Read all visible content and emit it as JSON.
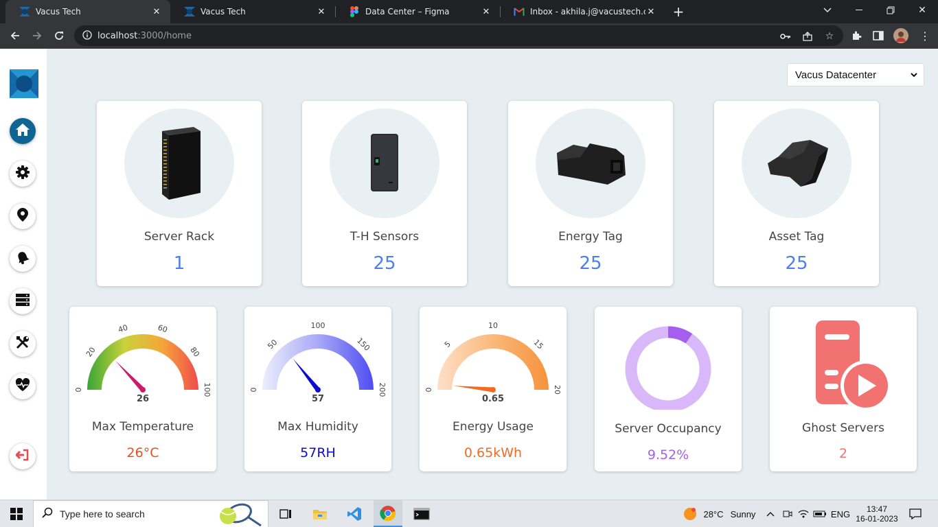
{
  "browser": {
    "tabs": [
      {
        "title": "Vacus Tech",
        "icon": "vacus-logo-icon",
        "active": true
      },
      {
        "title": "Vacus Tech",
        "icon": "vacus-logo-icon",
        "active": false
      },
      {
        "title": "Data Center – Figma",
        "icon": "figma-icon",
        "active": false
      },
      {
        "title": "Inbox - akhila.j@vacustech.com -",
        "icon": "gmail-icon",
        "active": false
      }
    ],
    "url_host": "localhost",
    "url_path": ":3000/home"
  },
  "sidebar": {
    "items": [
      {
        "name": "home",
        "icon": "home-icon",
        "active": true
      },
      {
        "name": "settings",
        "icon": "gear-icon",
        "active": false
      },
      {
        "name": "location",
        "icon": "location-pin-icon",
        "active": false
      },
      {
        "name": "alerts",
        "icon": "bell-icon",
        "active": false
      },
      {
        "name": "servers",
        "icon": "server-icon",
        "active": false
      },
      {
        "name": "tools",
        "icon": "tools-icon",
        "active": false
      },
      {
        "name": "health",
        "icon": "heartbeat-icon",
        "active": false
      },
      {
        "name": "logout",
        "icon": "logout-icon",
        "active": false
      }
    ]
  },
  "datacenter_select": {
    "value": "Vacus Datacenter"
  },
  "device_cards": [
    {
      "label": "Server Rack",
      "count": "1",
      "image": "server-rack-image"
    },
    {
      "label": "T-H Sensors",
      "count": "25",
      "image": "th-sensor-image"
    },
    {
      "label": "Energy Tag",
      "count": "25",
      "image": "energy-tag-image"
    },
    {
      "label": "Asset Tag",
      "count": "25",
      "image": "asset-tag-image"
    }
  ],
  "gauges": [
    {
      "label": "Max Temperature",
      "value_text": "26°C",
      "readout": "26",
      "value": 26,
      "min": 0,
      "max": 100,
      "ticks": [
        "0",
        "20",
        "40",
        "60",
        "80",
        "100"
      ],
      "value_color": "#e8501a"
    },
    {
      "label": "Max Humidity",
      "value_text": "57RH",
      "readout": "57",
      "value": 57,
      "min": 0,
      "max": 200,
      "ticks": [
        "0",
        "50",
        "100",
        "150",
        "200"
      ],
      "value_color": "#0b0bd3"
    },
    {
      "label": "Energy Usage",
      "value_text": "0.65kWh",
      "readout": "0.65",
      "value": 0.65,
      "min": 0,
      "max": 20,
      "ticks": [
        "0",
        "5",
        "10",
        "15",
        "20"
      ],
      "value_color": "#f26b21"
    }
  ],
  "occupancy": {
    "label": "Server Occupancy",
    "value_text": "9.52%",
    "fraction": 0.0952,
    "color": "#a45ef0",
    "track_color": "#d9b8f9"
  },
  "ghost": {
    "label": "Ghost Servers",
    "value_text": "2",
    "color": "#f27272"
  },
  "taskbar": {
    "search_placeholder": "Type here to search",
    "weather_temp": "28°C",
    "weather_desc": "Sunny",
    "language": "ENG",
    "time": "13:47",
    "date": "16-01-2023"
  }
}
